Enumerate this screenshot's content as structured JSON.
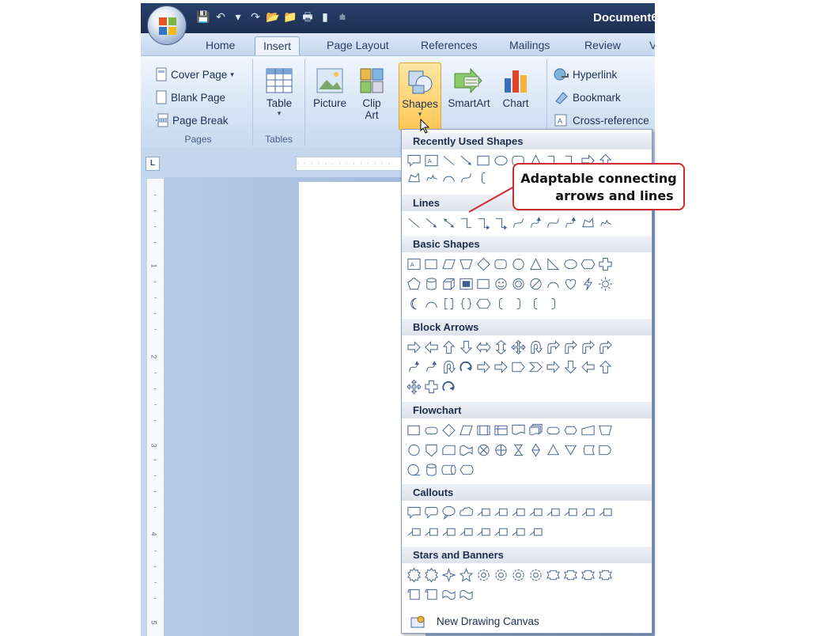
{
  "window": {
    "title": "Document6"
  },
  "tabs": [
    {
      "label": "Home"
    },
    {
      "label": "Insert"
    },
    {
      "label": "Page Layout"
    },
    {
      "label": "References"
    },
    {
      "label": "Mailings"
    },
    {
      "label": "Review"
    },
    {
      "label": "V"
    }
  ],
  "ribbon": {
    "pages": {
      "cover_page": "Cover Page",
      "blank_page": "Blank Page",
      "page_break": "Page Break",
      "group_label": "Pages"
    },
    "tables": {
      "table": "Table",
      "group_label": "Tables"
    },
    "illustrations": {
      "picture": "Picture",
      "clip_art_1": "Clip",
      "clip_art_2": "Art",
      "shapes": "Shapes",
      "smartart": "SmartArt",
      "chart": "Chart",
      "group_label": "Il"
    },
    "links": {
      "hyperlink": "Hyperlink",
      "bookmark": "Bookmark",
      "cross_reference": "Cross-reference"
    }
  },
  "ruler": {
    "corner": "L",
    "vertical_numbers": [
      "1",
      "2",
      "3",
      "4",
      "5"
    ]
  },
  "gallery": {
    "sections": [
      "Recently Used Shapes",
      "Lines",
      "Basic Shapes",
      "Block Arrows",
      "Flowchart",
      "Callouts",
      "Stars and Banners"
    ],
    "new_drawing_canvas": "New Drawing Canvas"
  },
  "annotation": {
    "line1": "Adaptable connecting",
    "line2": "arrows and lines"
  },
  "colors": {
    "accent": "#cf2a30",
    "highlight": "#ffc755",
    "title_bar": "#1d2f52"
  }
}
